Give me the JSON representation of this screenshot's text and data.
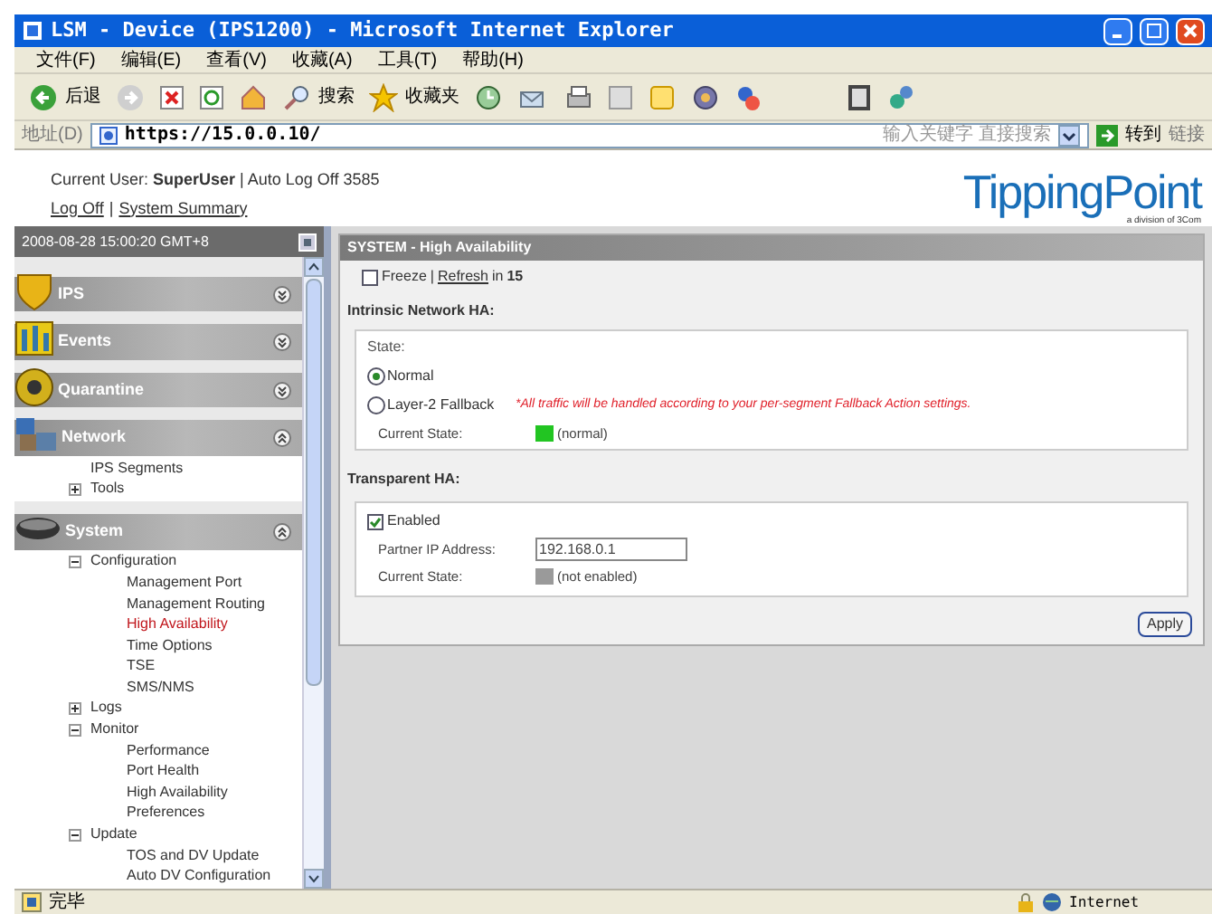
{
  "window": {
    "title": "LSM - Device (IPS1200) - Microsoft Internet Explorer"
  },
  "menu": [
    "文件(F)",
    "编辑(E)",
    "查看(V)",
    "收藏(A)",
    "工具(T)",
    "帮助(H)"
  ],
  "toolbar": {
    "back": "后退",
    "search": "搜索",
    "favorites": "收藏夹"
  },
  "address_bar": {
    "label": "地址(D)",
    "url": "https://15.0.0.10/",
    "search_placeholder": "输入关键字 直接搜索",
    "go": "转到",
    "links": "链接"
  },
  "header": {
    "user_prefix": "Current User:",
    "user": "SuperUser",
    "auto_log_off": "| Auto Log Off 3585",
    "log_off": "Log Off",
    "separator": "|",
    "system_summary": "System Summary",
    "brand": "TippingPoint",
    "brand_sub": "a division of 3Com"
  },
  "sidebar": {
    "timestamp": "2008-08-28 15:00:20 GMT+8",
    "sections": [
      {
        "label": "IPS",
        "expanded": false
      },
      {
        "label": "Events",
        "expanded": false
      },
      {
        "label": "Quarantine",
        "expanded": false
      },
      {
        "label": "Network",
        "expanded": true,
        "children": [
          {
            "label": "IPS Segments",
            "selected": false
          },
          {
            "label": "Tools",
            "expanded": false
          }
        ]
      },
      {
        "label": "System",
        "expanded": true,
        "children": [
          {
            "label": "Configuration",
            "expanded": true,
            "children": [
              {
                "label": "Management Port",
                "selected": false
              },
              {
                "label": "Management Routing",
                "selected": false
              },
              {
                "label": "High Availability",
                "selected": true
              },
              {
                "label": "Time Options",
                "selected": false
              },
              {
                "label": "TSE",
                "selected": false
              },
              {
                "label": "SMS/NMS",
                "selected": false
              }
            ]
          },
          {
            "label": "Logs",
            "expanded": false
          },
          {
            "label": "Monitor",
            "expanded": true,
            "children": [
              {
                "label": "Performance",
                "selected": false
              },
              {
                "label": "Port Health",
                "selected": false
              },
              {
                "label": "High Availability",
                "selected": false
              },
              {
                "label": "Preferences",
                "selected": false
              }
            ]
          },
          {
            "label": "Update",
            "expanded": true,
            "children": [
              {
                "label": "TOS and DV Update",
                "selected": false
              },
              {
                "label": "Auto DV Configuration",
                "selected": false
              }
            ]
          }
        ]
      }
    ]
  },
  "panel": {
    "title": "SYSTEM - High Availability",
    "freeze": {
      "label": "Freeze",
      "checked": false
    },
    "refresh_sep": "|",
    "refresh_link": "Refresh",
    "refresh_suffix": "in",
    "refresh_count": "15",
    "intrinsic": {
      "heading": "Intrinsic Network HA:",
      "state_label": "State:",
      "options": [
        {
          "label": "Normal",
          "selected": true
        },
        {
          "label": "Layer-2 Fallback",
          "selected": false
        }
      ],
      "note": "*All traffic will be handled according to your per-segment Fallback Action settings.",
      "current_state_label": "Current State:",
      "current_state": {
        "text": "(normal)",
        "kind": "normal"
      }
    },
    "transparent": {
      "heading": "Transparent HA:",
      "enabled": {
        "label": "Enabled",
        "checked": true
      },
      "partner_label": "Partner IP Address:",
      "partner_value": "192.168.0.1",
      "current_state_label": "Current State:",
      "current_state": {
        "text": "(not enabled)",
        "kind": "disabled"
      }
    },
    "apply": "Apply"
  },
  "status_bar": {
    "text": "完毕",
    "zone": "Internet"
  }
}
